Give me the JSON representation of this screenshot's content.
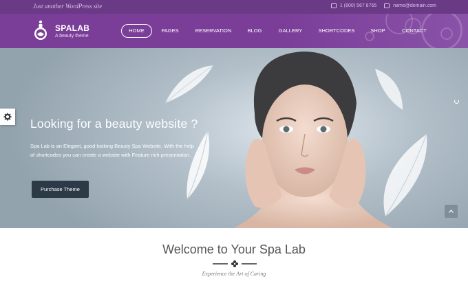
{
  "topbar": {
    "tagline": "Just another WordPress site",
    "phone": "1 (800) 567 8765",
    "email": "name@domain.com"
  },
  "header": {
    "logo_name": "SPALAB",
    "logo_tagline": "A beauty theme",
    "nav": [
      "HOME",
      "PAGES",
      "RESERVATION",
      "BLOG",
      "GALLERY",
      "SHORTCODES",
      "SHOP",
      "CONTACT"
    ],
    "active_nav": "HOME"
  },
  "hero": {
    "title": "Looking for a beauty website ?",
    "description": "Spa Lab is an Elegant, good looking Beauty Spa Website. With the help of shortcodes you can create a website with Feature rich presentation.",
    "button_label": "Purchase Theme"
  },
  "welcome": {
    "title": "Welcome to Your Spa Lab",
    "subtitle": "Experience the Art of Caring"
  },
  "colors": {
    "brand_purple": "#7a3d98",
    "topbar_purple": "#6a3a86",
    "button_dark": "#2c3a47"
  },
  "icons": [
    "phone-icon",
    "email-icon",
    "gear-icon",
    "arrow-up-icon",
    "flower-icon",
    "loading-icon"
  ]
}
